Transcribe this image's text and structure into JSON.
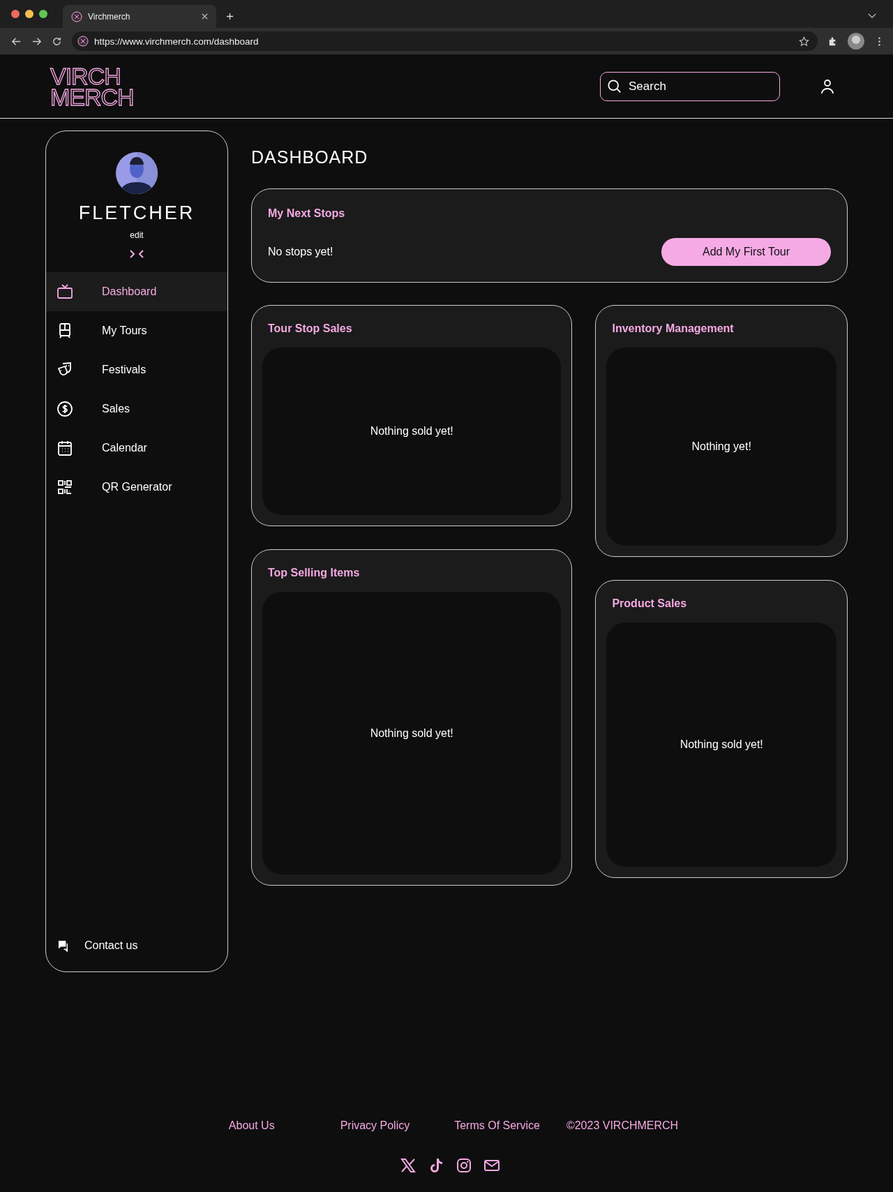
{
  "browser": {
    "tab_title": "Virchmerch",
    "url": "https://www.virchmerch.com/dashboard"
  },
  "header": {
    "logo": [
      "VIRCH",
      "MERCH"
    ],
    "search": {
      "placeholder": "Search"
    }
  },
  "sidebar": {
    "name": "FLETCHER",
    "edit": "edit",
    "items": [
      {
        "label": "Dashboard",
        "selected": true
      },
      {
        "label": "My Tours",
        "selected": false
      },
      {
        "label": "Festivals",
        "selected": false
      },
      {
        "label": "Sales",
        "selected": false
      },
      {
        "label": "Calendar",
        "selected": false
      },
      {
        "label": "QR Generator",
        "selected": false
      }
    ],
    "contact": "Contact us"
  },
  "page_title": "DASHBOARD",
  "next_stops": {
    "title": "My Next Stops",
    "empty": "No stops yet!",
    "button": "Add My First Tour"
  },
  "columns": [
    [
      {
        "title": "Tour Stop Sales",
        "empty": "Nothing sold yet!"
      },
      {
        "title": "Top Selling Items",
        "empty": "Nothing sold yet!"
      }
    ],
    [
      {
        "title": "Inventory Management",
        "empty": "Nothing yet!"
      },
      {
        "title": "Product Sales",
        "empty": "Nothing sold yet!"
      }
    ]
  ],
  "footer": {
    "links": [
      "About Us",
      "Privacy Policy",
      "Terms Of Service"
    ],
    "copyright": "©2023 VIRCHMERCH"
  }
}
